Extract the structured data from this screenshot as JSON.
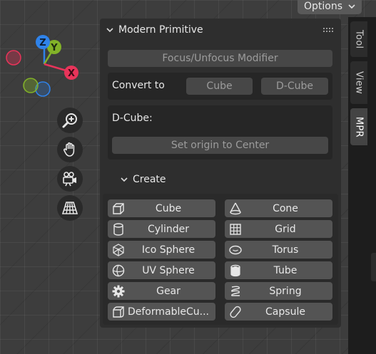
{
  "viewport": {
    "gizmo": {
      "z_label": "Z",
      "y_label": "Y",
      "x_label": "X",
      "colors": {
        "z": "#2f83ea",
        "y": "#82b228",
        "x": "#e8345a"
      }
    },
    "nav_tools": [
      {
        "name": "zoom-icon"
      },
      {
        "name": "hand-pan-icon"
      },
      {
        "name": "camera-icon"
      },
      {
        "name": "perspective-grid-icon"
      }
    ]
  },
  "header": {
    "options_label": "Options"
  },
  "tabs": [
    {
      "label": "Tool",
      "active": false
    },
    {
      "label": "View",
      "active": false
    },
    {
      "label": "MPR",
      "active": true
    }
  ],
  "panel": {
    "title": "Modern Primitive",
    "focus_button": "Focus/Unfocus Modifier",
    "convert": {
      "label": "Convert to",
      "options": [
        "Cube",
        "D-Cube"
      ]
    },
    "dcube": {
      "label": "D-Cube:",
      "set_origin_button": "Set origin to Center"
    },
    "create": {
      "title": "Create",
      "items": [
        {
          "label": "Cube",
          "icon": "cube-icon"
        },
        {
          "label": "Cone",
          "icon": "cone-icon"
        },
        {
          "label": "Cylinder",
          "icon": "cylinder-icon"
        },
        {
          "label": "Grid",
          "icon": "grid-icon"
        },
        {
          "label": "Ico Sphere",
          "icon": "ico-sphere-icon"
        },
        {
          "label": "Torus",
          "icon": "torus-icon"
        },
        {
          "label": "UV Sphere",
          "icon": "uv-sphere-icon"
        },
        {
          "label": "Tube",
          "icon": "tube-icon"
        },
        {
          "label": "Gear",
          "icon": "gear-icon"
        },
        {
          "label": "Spring",
          "icon": "spring-icon"
        },
        {
          "label": "DeformableCu...",
          "icon": "deformable-cube-icon"
        },
        {
          "label": "Capsule",
          "icon": "capsule-icon"
        }
      ]
    }
  }
}
